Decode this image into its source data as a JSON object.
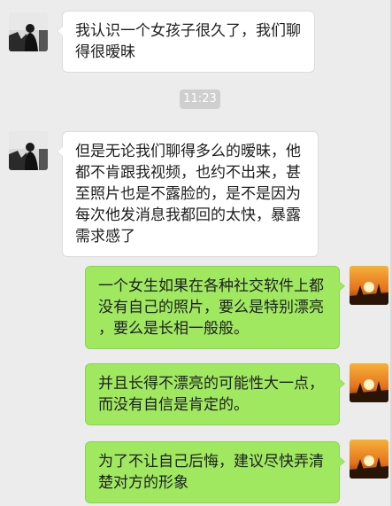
{
  "chat": {
    "timestamp": "11:23",
    "messages": [
      {
        "sender": "contact",
        "lines": [
          "我认识一个女孩子很久了，我们聊",
          "得很暧昧"
        ]
      },
      {
        "sender": "contact",
        "lines": [
          "但是无论我们聊得多么的暧昧，他",
          "都不肯跟我视频，也约不出来，甚",
          "至照片也是不露脸的，是不是因为",
          "每次他发消息我都回的太快，暴露",
          "需求感了"
        ]
      },
      {
        "sender": "me",
        "lines": [
          "一个女生如果在各种社交软件上都",
          "没有自己的照片，要么是特别漂亮",
          "，要么是长相一般般。"
        ]
      },
      {
        "sender": "me",
        "lines": [
          "并且长得不漂亮的可能性大一点，",
          "而没有自信是肯定的。"
        ]
      },
      {
        "sender": "me",
        "lines": [
          "为了不让自己后悔，建议尽快弄清",
          "楚对方的形象"
        ]
      }
    ]
  },
  "colors": {
    "background": "#ececec",
    "incoming_bubble": "#ffffff",
    "outgoing_bubble": "#9fe85f"
  },
  "icons": {
    "contact_avatar": "dark-silhouette-avatar-icon",
    "my_avatar": "sunset-silhouette-avatar-icon"
  }
}
